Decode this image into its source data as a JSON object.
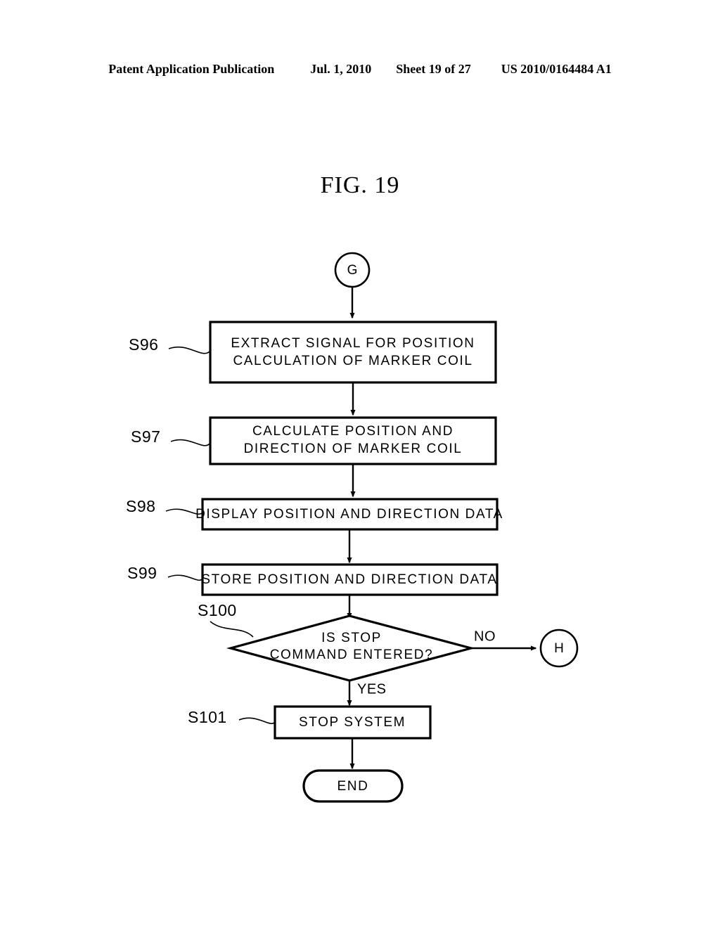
{
  "header": {
    "publication": "Patent Application Publication",
    "date": "Jul. 1, 2010",
    "sheet": "Sheet 19 of 27",
    "docnumber": "US 2010/0164484 A1"
  },
  "figure": {
    "title": "FIG. 19"
  },
  "flowchart": {
    "entry_connector": {
      "label": "G"
    },
    "exit_connector": {
      "label": "H"
    },
    "terminator": {
      "label": "END"
    },
    "branch_labels": {
      "no": "NO",
      "yes": "YES"
    },
    "steps": [
      {
        "ref": "S96",
        "type": "process",
        "lines": [
          "EXTRACT SIGNAL FOR POSITION",
          "CALCULATION OF MARKER COIL"
        ]
      },
      {
        "ref": "S97",
        "type": "process",
        "lines": [
          "CALCULATE POSITION AND",
          "DIRECTION OF MARKER COIL"
        ]
      },
      {
        "ref": "S98",
        "type": "process",
        "lines": [
          "DISPLAY POSITION AND DIRECTION DATA"
        ]
      },
      {
        "ref": "S99",
        "type": "process",
        "lines": [
          "STORE POSITION AND DIRECTION DATA"
        ]
      },
      {
        "ref": "S100",
        "type": "decision",
        "lines": [
          "IS STOP",
          "COMMAND ENTERED?"
        ]
      },
      {
        "ref": "S101",
        "type": "process",
        "lines": [
          "STOP SYSTEM"
        ]
      }
    ]
  },
  "colors": {
    "ink": "#000000",
    "paper": "#ffffff"
  }
}
